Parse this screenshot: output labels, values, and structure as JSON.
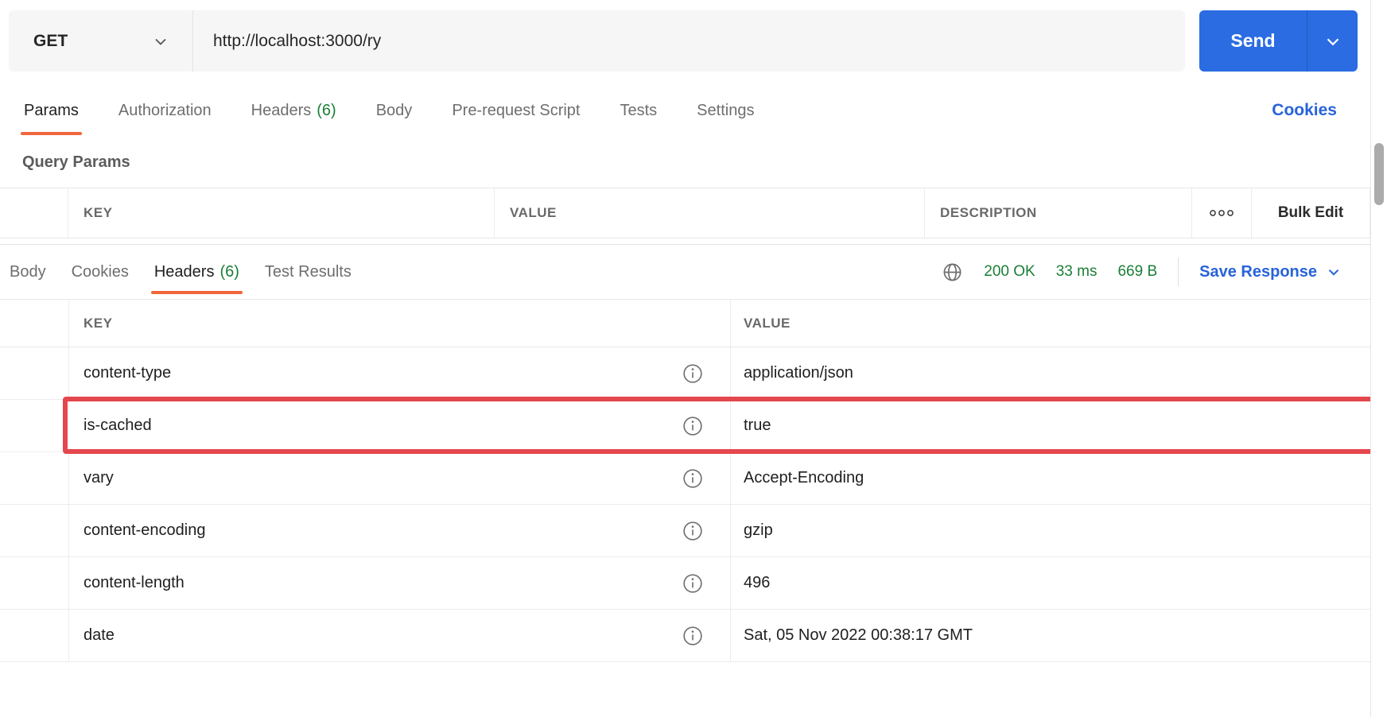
{
  "request": {
    "method": "GET",
    "url": "http://localhost:3000/ry",
    "send_label": "Send",
    "tabs": [
      {
        "label": "Params"
      },
      {
        "label": "Authorization"
      },
      {
        "label": "Headers",
        "count": "(6)"
      },
      {
        "label": "Body"
      },
      {
        "label": "Pre-request Script"
      },
      {
        "label": "Tests"
      },
      {
        "label": "Settings"
      }
    ],
    "cookies_link": "Cookies",
    "query_params": {
      "section_title": "Query Params",
      "col_key": "KEY",
      "col_value": "VALUE",
      "col_description": "DESCRIPTION",
      "bulk_edit_label": "Bulk Edit"
    }
  },
  "response": {
    "tabs": [
      {
        "label": "Body"
      },
      {
        "label": "Cookies"
      },
      {
        "label": "Headers",
        "count": "(6)"
      },
      {
        "label": "Test Results"
      }
    ],
    "status": {
      "code": "200 OK",
      "time": "33 ms",
      "size": "669 B"
    },
    "save_label": "Save Response",
    "table": {
      "col_key": "KEY",
      "col_value": "VALUE",
      "rows": [
        {
          "key": "content-type",
          "value": "application/json"
        },
        {
          "key": "is-cached",
          "value": "true"
        },
        {
          "key": "vary",
          "value": "Accept-Encoding"
        },
        {
          "key": "content-encoding",
          "value": "gzip"
        },
        {
          "key": "content-length",
          "value": "496"
        },
        {
          "key": "date",
          "value": "Sat, 05 Nov 2022 00:38:17 GMT"
        }
      ]
    }
  },
  "colors": {
    "accent_orange": "#ef663b",
    "action_blue": "#2b6ce2",
    "link_blue": "#2763d9",
    "success_green": "#1a7f37",
    "highlight_red": "#e4474d"
  }
}
